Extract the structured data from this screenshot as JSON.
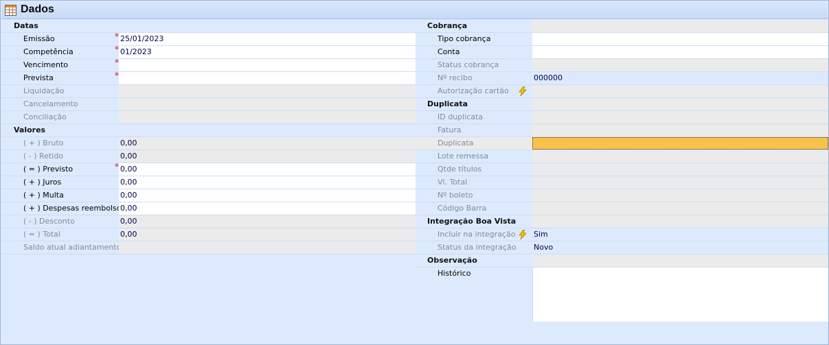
{
  "window": {
    "title": "Dados",
    "title_icon": "table-grid-icon"
  },
  "colors": {
    "selection": "#f8c24a",
    "required": "#c8102e",
    "header_bg": "#ddeafd"
  },
  "left": {
    "datas": {
      "section": "Datas",
      "emissao": {
        "label": "Emissão",
        "value": "25/01/2023"
      },
      "competencia": {
        "label": "Competência",
        "value": "01/2023"
      },
      "vencimento": {
        "label": "Vencimento",
        "value": ""
      },
      "prevista": {
        "label": "Prevista",
        "value": ""
      },
      "liquidacao": {
        "label": "Liquidação",
        "value": ""
      },
      "cancelamento": {
        "label": "Cancelamento",
        "value": ""
      },
      "conciliacao": {
        "label": "Conciliação",
        "value": ""
      }
    },
    "valores": {
      "section": "Valores",
      "bruto": {
        "label": "( + ) Bruto",
        "value": "0,00"
      },
      "retido": {
        "label": "( - ) Retido",
        "value": "0,00"
      },
      "previsto": {
        "label": "( = ) Previsto",
        "value": "0,00"
      },
      "juros": {
        "label": "( + ) Juros",
        "value": "0,00"
      },
      "multa": {
        "label": "( + ) Multa",
        "value": "0,00"
      },
      "despesas": {
        "label": "( + ) Despesas reembolso",
        "value": "0,00"
      },
      "desconto": {
        "label": "( - ) Desconto",
        "value": "0,00"
      },
      "total": {
        "label": "( = ) Total",
        "value": "0,00"
      },
      "saldo": {
        "label": "Saldo atual adiantamento",
        "value": ""
      }
    }
  },
  "right": {
    "cobranca": {
      "section": "Cobrança",
      "tipo": {
        "label": "Tipo cobrança",
        "value": ""
      },
      "conta": {
        "label": "Conta",
        "value": ""
      },
      "status": {
        "label": "Status cobrança",
        "value": ""
      },
      "recibo": {
        "label": "Nº recibo",
        "value": "000000"
      },
      "autorizacao": {
        "label": "Autorização cartão",
        "value": ""
      }
    },
    "duplicata": {
      "section": "Duplicata",
      "id": {
        "label": "ID duplicata",
        "value": ""
      },
      "fatura": {
        "label": "Fatura",
        "value": ""
      },
      "duplicata": {
        "label": "Duplicata",
        "value": ""
      },
      "lote": {
        "label": "Lote remessa",
        "value": ""
      },
      "qtde": {
        "label": "Qtde títulos",
        "value": ""
      },
      "vl_total": {
        "label": "Vl. Total",
        "value": ""
      },
      "boleto": {
        "label": "Nº boleto",
        "value": ""
      },
      "codigo_barra": {
        "label": "Código Barra",
        "value": ""
      }
    },
    "integracao": {
      "section": "Integração Boa Vista",
      "incluir": {
        "label": "Incluir na integração",
        "value": "Sim"
      },
      "status": {
        "label": "Status da integração",
        "value": "Novo"
      }
    },
    "observacao": {
      "section": "Observação",
      "historico": {
        "label": "Histórico",
        "value": ""
      }
    }
  },
  "required_mark": "*"
}
